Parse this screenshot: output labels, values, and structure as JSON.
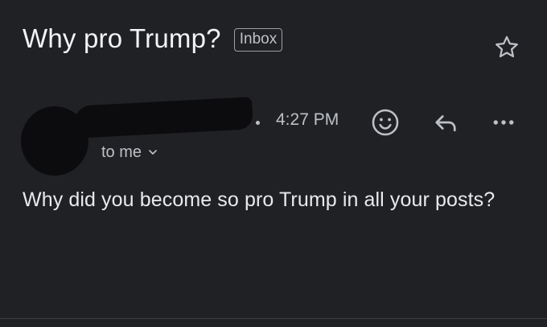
{
  "subject": "Why pro Trump?",
  "label": "Inbox",
  "sender": {
    "name": "",
    "time": "4:27 PM",
    "recipients": "to me"
  },
  "message": {
    "body": "Why did you become so pro Trump in all your posts?"
  },
  "icons": {
    "star": "star-outline-icon",
    "emoji": "smiley-icon",
    "reply": "reply-icon",
    "more": "more-horizontal-icon",
    "recipients_toggle": "chevron-down-icon"
  },
  "colors": {
    "background": "#202124",
    "text_primary": "#e8eaed",
    "text_secondary": "#bdc1c6",
    "redaction": "#0c0c0e"
  }
}
